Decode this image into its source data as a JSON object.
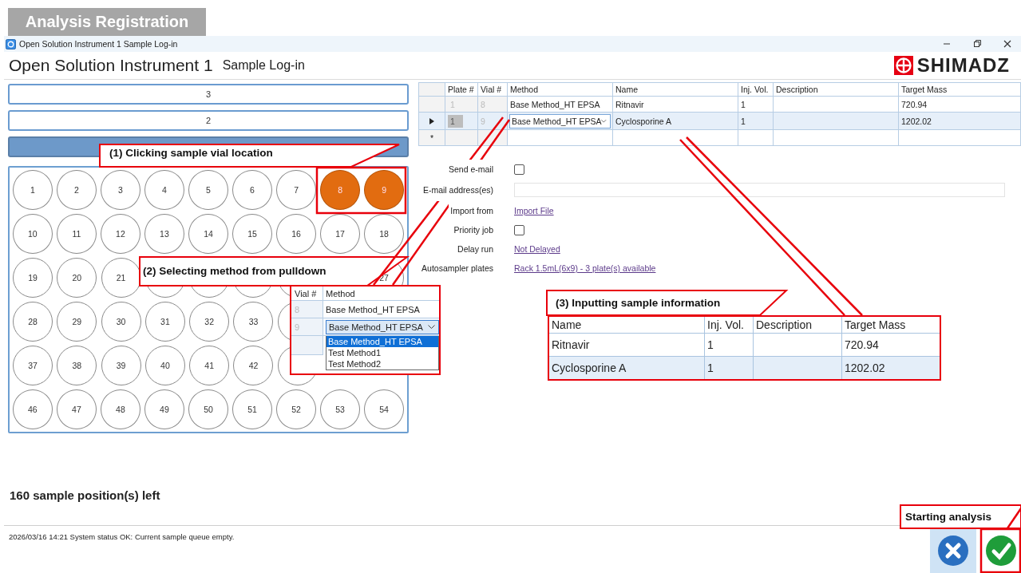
{
  "banner": {
    "title": "Analysis Registration"
  },
  "window": {
    "title": "Open Solution Instrument 1 Sample Log-in"
  },
  "header": {
    "title": "Open Solution Instrument 1",
    "subtitle": "Sample Log-in",
    "logo": "SHIMADZ"
  },
  "plates": [
    {
      "label": "3",
      "selected": false
    },
    {
      "label": "2",
      "selected": false
    },
    {
      "selected": true
    }
  ],
  "vial_rows": [
    {
      "vials": [
        {
          "label": "1",
          "selected": false
        },
        {
          "label": "2",
          "selected": false
        },
        {
          "label": "3",
          "selected": false
        },
        {
          "label": "4",
          "selected": false
        },
        {
          "label": "5",
          "selected": false
        },
        {
          "label": "6",
          "selected": false
        },
        {
          "label": "7",
          "selected": false
        },
        {
          "label": "8",
          "selected": true
        },
        {
          "label": "9",
          "selected": true
        }
      ]
    },
    {
      "vials": [
        {
          "label": "10",
          "selected": false
        },
        {
          "label": "11",
          "selected": false
        },
        {
          "label": "12",
          "selected": false
        },
        {
          "label": "13",
          "selected": false
        },
        {
          "label": "14",
          "selected": false
        },
        {
          "label": "15",
          "selected": false
        },
        {
          "label": "16",
          "selected": false
        },
        {
          "label": "17",
          "selected": false
        },
        {
          "label": "18",
          "selected": false
        }
      ]
    },
    {
      "vials": [
        {
          "label": "19",
          "selected": false
        },
        {
          "label": "20",
          "selected": false
        },
        {
          "label": "21",
          "selected": false
        },
        {
          "selected": false
        },
        {
          "selected": false
        },
        {
          "selected": false
        },
        {
          "selected": false
        },
        {
          "label": "27",
          "selected": false
        }
      ]
    },
    {
      "vials": [
        {
          "label": "28",
          "selected": false
        },
        {
          "label": "29",
          "selected": false
        },
        {
          "label": "30",
          "selected": false
        },
        {
          "label": "31",
          "selected": false
        },
        {
          "label": "32",
          "selected": false
        },
        {
          "label": "33",
          "selected": false
        },
        {
          "selected": false
        }
      ]
    },
    {
      "vials": [
        {
          "label": "37",
          "selected": false
        },
        {
          "label": "38",
          "selected": false
        },
        {
          "label": "39",
          "selected": false
        },
        {
          "label": "40",
          "selected": false
        },
        {
          "label": "41",
          "selected": false
        },
        {
          "label": "42",
          "selected": false
        },
        {
          "selected": false
        }
      ]
    },
    {
      "vials": [
        {
          "label": "46",
          "selected": false
        },
        {
          "label": "47",
          "selected": false
        },
        {
          "label": "48",
          "selected": false
        },
        {
          "label": "49",
          "selected": false
        },
        {
          "label": "50",
          "selected": false
        },
        {
          "label": "51",
          "selected": false
        },
        {
          "label": "52",
          "selected": false
        },
        {
          "label": "53",
          "selected": false
        },
        {
          "label": "54",
          "selected": false
        }
      ]
    }
  ],
  "positions_left": "160 sample position(s) left",
  "status_bar": "2026/03/16 14:21 System status OK:  Current sample queue empty.",
  "sample_table": {
    "columns": [
      "Plate #",
      "Vial #",
      "Method",
      "Name",
      "Inj. Vol.",
      "Description",
      "Target Mass"
    ],
    "rows": [
      {
        "current": false,
        "plate": "1",
        "vial": "8",
        "method": "Base Method_HT EPSA",
        "name": "Ritnavir",
        "inj_vol": "1",
        "target_mass": "720.94"
      },
      {
        "current": true,
        "plate": "1",
        "vial": "9",
        "method": "Base Method_HT EPSA",
        "name": "Cyclosporine A",
        "inj_vol": "1",
        "target_mass": "1202.02"
      }
    ],
    "new_row_marker": "*"
  },
  "form": [
    {
      "kind": "checkbox",
      "label": "Send e-mail",
      "checked": false
    },
    {
      "kind": "input",
      "label": "E-mail address(es)"
    },
    {
      "kind": "link",
      "label": "Import from",
      "value": "Import File"
    },
    {
      "kind": "checkbox",
      "label": "Priority job",
      "checked": false
    },
    {
      "kind": "link",
      "label": "Delay run",
      "value": "Not Delayed"
    },
    {
      "kind": "link",
      "label": "Autosampler plates",
      "value": "Rack 1.5mL(6x9) - 3 plate(s) available"
    }
  ],
  "callouts": [
    {
      "text": "(1) Clicking sample vial location"
    },
    {
      "text": "(2) Selecting method from pulldown"
    },
    {
      "text": "(3) Inputting sample information"
    },
    {
      "text": "Starting analysis"
    }
  ],
  "dropdown_inset": {
    "columns": [
      "Vial #",
      "Method"
    ],
    "rows": [
      {
        "vial": "8",
        "method": "Base Method_HT EPSA",
        "editing": false
      },
      {
        "vial": "9",
        "method": "Base Method_HT EPSA",
        "editing": true
      }
    ],
    "options": [
      {
        "label": "Base Method_HT EPSA",
        "selected": true
      },
      {
        "label": "Test Method1",
        "selected": false
      },
      {
        "label": "Test Method2",
        "selected": false
      }
    ]
  },
  "info_inset": {
    "columns": [
      "Name",
      "Inj. Vol.",
      "Description",
      "Target Mass"
    ],
    "rows": [
      {
        "name": "Ritnavir",
        "inj_vol": "1",
        "target_mass": "720.94"
      },
      {
        "name": "Cyclosporine A",
        "inj_vol": "1",
        "target_mass": "1202.02"
      }
    ]
  }
}
